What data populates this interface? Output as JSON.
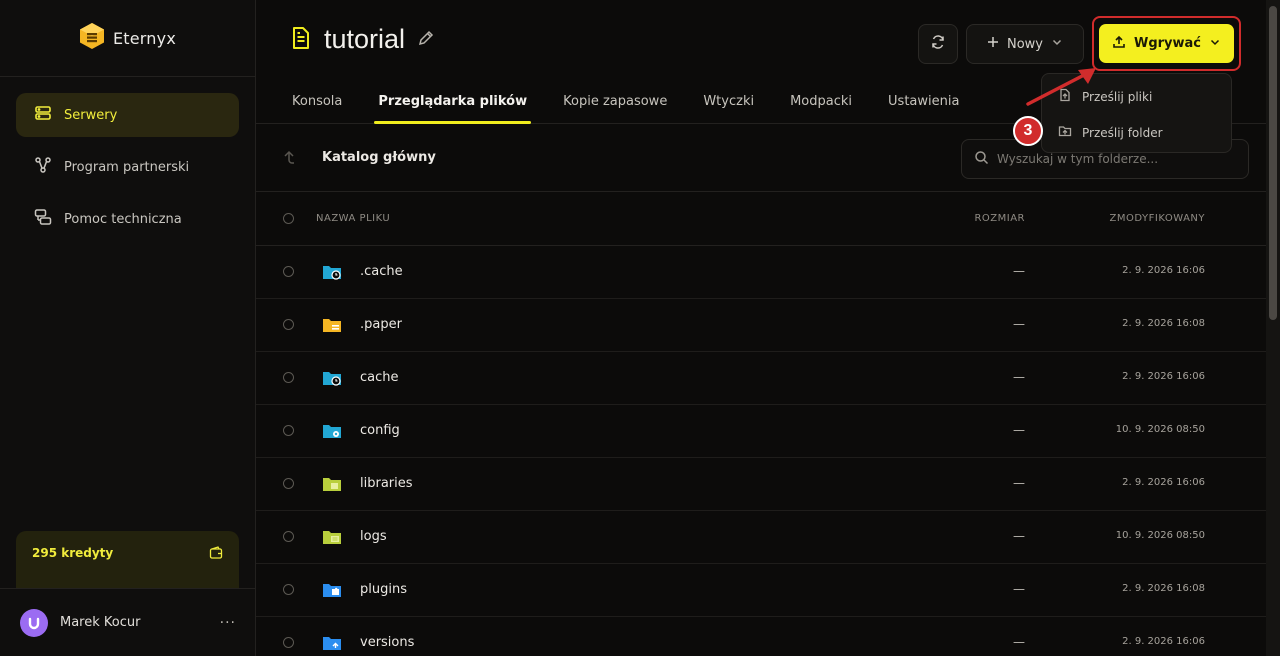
{
  "brand": {
    "name": "Eternyx",
    "color": "#f5b623"
  },
  "sidebar": {
    "items": [
      {
        "label": "Serwery",
        "icon": "server-icon",
        "active": true
      },
      {
        "label": "Program partnerski",
        "icon": "share-nodes-icon",
        "active": false
      },
      {
        "label": "Pomoc techniczna",
        "icon": "chat-bubbles-icon",
        "active": false
      }
    ],
    "credits": "295 kredyty",
    "user": {
      "name": "Marek Kocur",
      "more": "···"
    }
  },
  "header": {
    "title": "tutorial",
    "new_label": "Nowy",
    "upload_label": "Wgrywać"
  },
  "tabs": [
    {
      "label": "Konsola",
      "active": false
    },
    {
      "label": "Przeglądarka plików",
      "active": true
    },
    {
      "label": "Kopie zapasowe",
      "active": false
    },
    {
      "label": "Wtyczki",
      "active": false
    },
    {
      "label": "Modpacki",
      "active": false
    },
    {
      "label": "Ustawienia",
      "active": false
    }
  ],
  "pathbar": {
    "label": "Katalog główny",
    "search_placeholder": "Wyszukaj w tym folderze..."
  },
  "table": {
    "headers": {
      "name": "NAZWA PLIKU",
      "size": "ROZMIAR",
      "modified": "ZMODYFIKOWANY"
    },
    "rows": [
      {
        "name": ".cache",
        "size": "—",
        "modified": "2. 9. 2026 16:06",
        "icon": "folder-clock-icon",
        "color": "#22a7d4"
      },
      {
        "name": ".paper",
        "size": "—",
        "modified": "2. 9. 2026 16:08",
        "icon": "folder-paper-icon",
        "color": "#f5b623"
      },
      {
        "name": "cache",
        "size": "—",
        "modified": "2. 9. 2026 16:06",
        "icon": "folder-clock-icon",
        "color": "#22a7d4"
      },
      {
        "name": "config",
        "size": "—",
        "modified": "10. 9. 2026 08:50",
        "icon": "folder-gear-icon",
        "color": "#22a7d4"
      },
      {
        "name": "libraries",
        "size": "—",
        "modified": "2. 9. 2026 16:06",
        "icon": "folder-library-icon",
        "color": "#b9cf3c"
      },
      {
        "name": "logs",
        "size": "—",
        "modified": "10. 9. 2026 08:50",
        "icon": "folder-log-icon",
        "color": "#b9cf3c"
      },
      {
        "name": "plugins",
        "size": "—",
        "modified": "2. 9. 2026 16:08",
        "icon": "folder-puzzle-icon",
        "color": "#2b8ef0"
      },
      {
        "name": "versions",
        "size": "—",
        "modified": "2. 9. 2026 16:06",
        "icon": "folder-upload-icon",
        "color": "#2b8ef0"
      }
    ]
  },
  "upload_menu": {
    "items": [
      {
        "label": "Prześlij pliki",
        "icon": "upload-file-icon"
      },
      {
        "label": "Prześlij folder",
        "icon": "upload-folder-icon"
      }
    ]
  },
  "annotation": {
    "step": "3",
    "color": "#d12c2c"
  }
}
